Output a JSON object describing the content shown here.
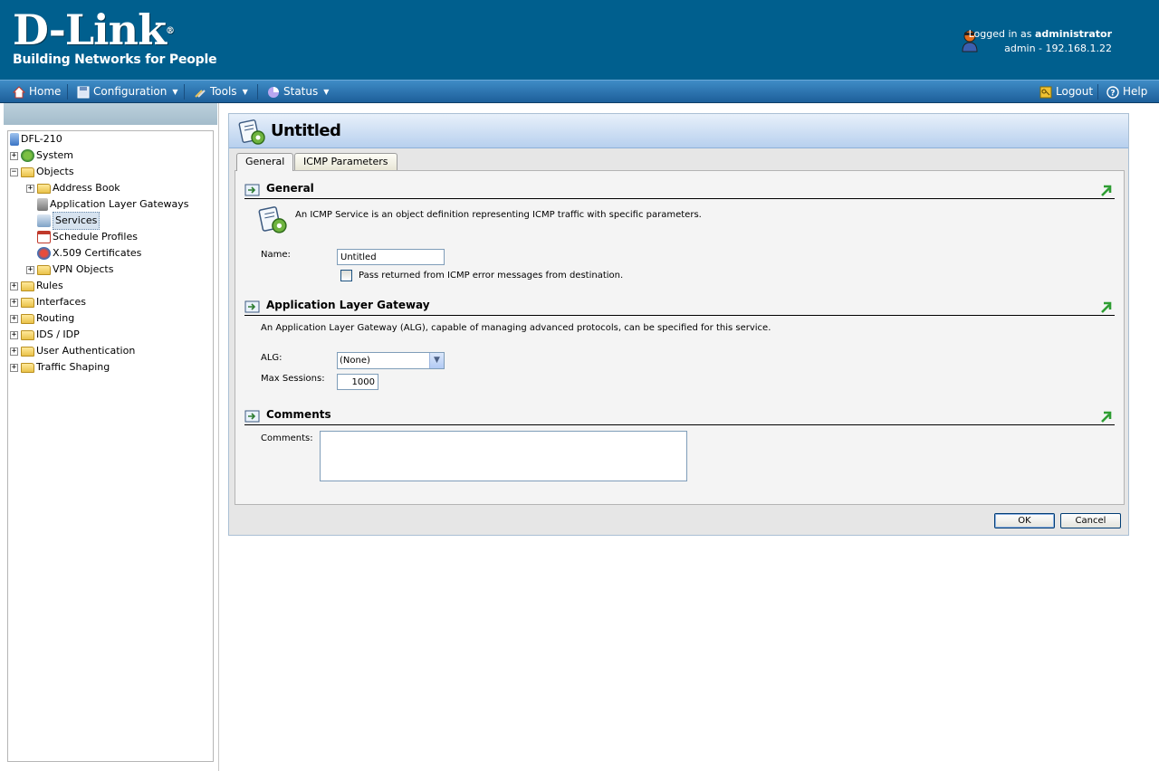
{
  "header": {
    "logo_main": "D-Link",
    "logo_reg": "®",
    "logo_tagline": "Building Networks for People",
    "logged_in_prefix": "Logged in as",
    "logged_in_user": "administrator",
    "session_info": "admin - 192.168.1.22"
  },
  "toolbar": {
    "home": "Home",
    "configuration": "Configuration",
    "tools": "Tools",
    "status": "Status",
    "logout": "Logout",
    "help": "Help"
  },
  "tree": {
    "root": "DFL-210",
    "system": "System",
    "objects": "Objects",
    "address_book": "Address Book",
    "alg": "Application Layer Gateways",
    "services": "Services",
    "schedule": "Schedule Profiles",
    "x509": "X.509 Certificates",
    "vpn_objects": "VPN Objects",
    "rules": "Rules",
    "interfaces": "Interfaces",
    "routing": "Routing",
    "ids_idp": "IDS / IDP",
    "user_auth": "User Authentication",
    "traffic_shaping": "Traffic Shaping"
  },
  "page": {
    "title": "Untitled",
    "tabs": [
      "General",
      "ICMP Parameters"
    ]
  },
  "general": {
    "heading": "General",
    "description": "An ICMP Service is an object definition representing ICMP traffic with specific parameters.",
    "name_label": "Name:",
    "name_value": "Untitled",
    "pass_label": "Pass returned from ICMP error messages from destination."
  },
  "alg_section": {
    "heading": "Application Layer Gateway",
    "description": "An Application Layer Gateway (ALG), capable of managing advanced protocols, can be specified for this service.",
    "alg_label": "ALG:",
    "alg_value": "(None)",
    "max_sessions_label": "Max Sessions:",
    "max_sessions_value": "1000"
  },
  "comments": {
    "heading": "Comments",
    "label": "Comments:"
  },
  "buttons": {
    "ok": "OK",
    "cancel": "Cancel"
  }
}
